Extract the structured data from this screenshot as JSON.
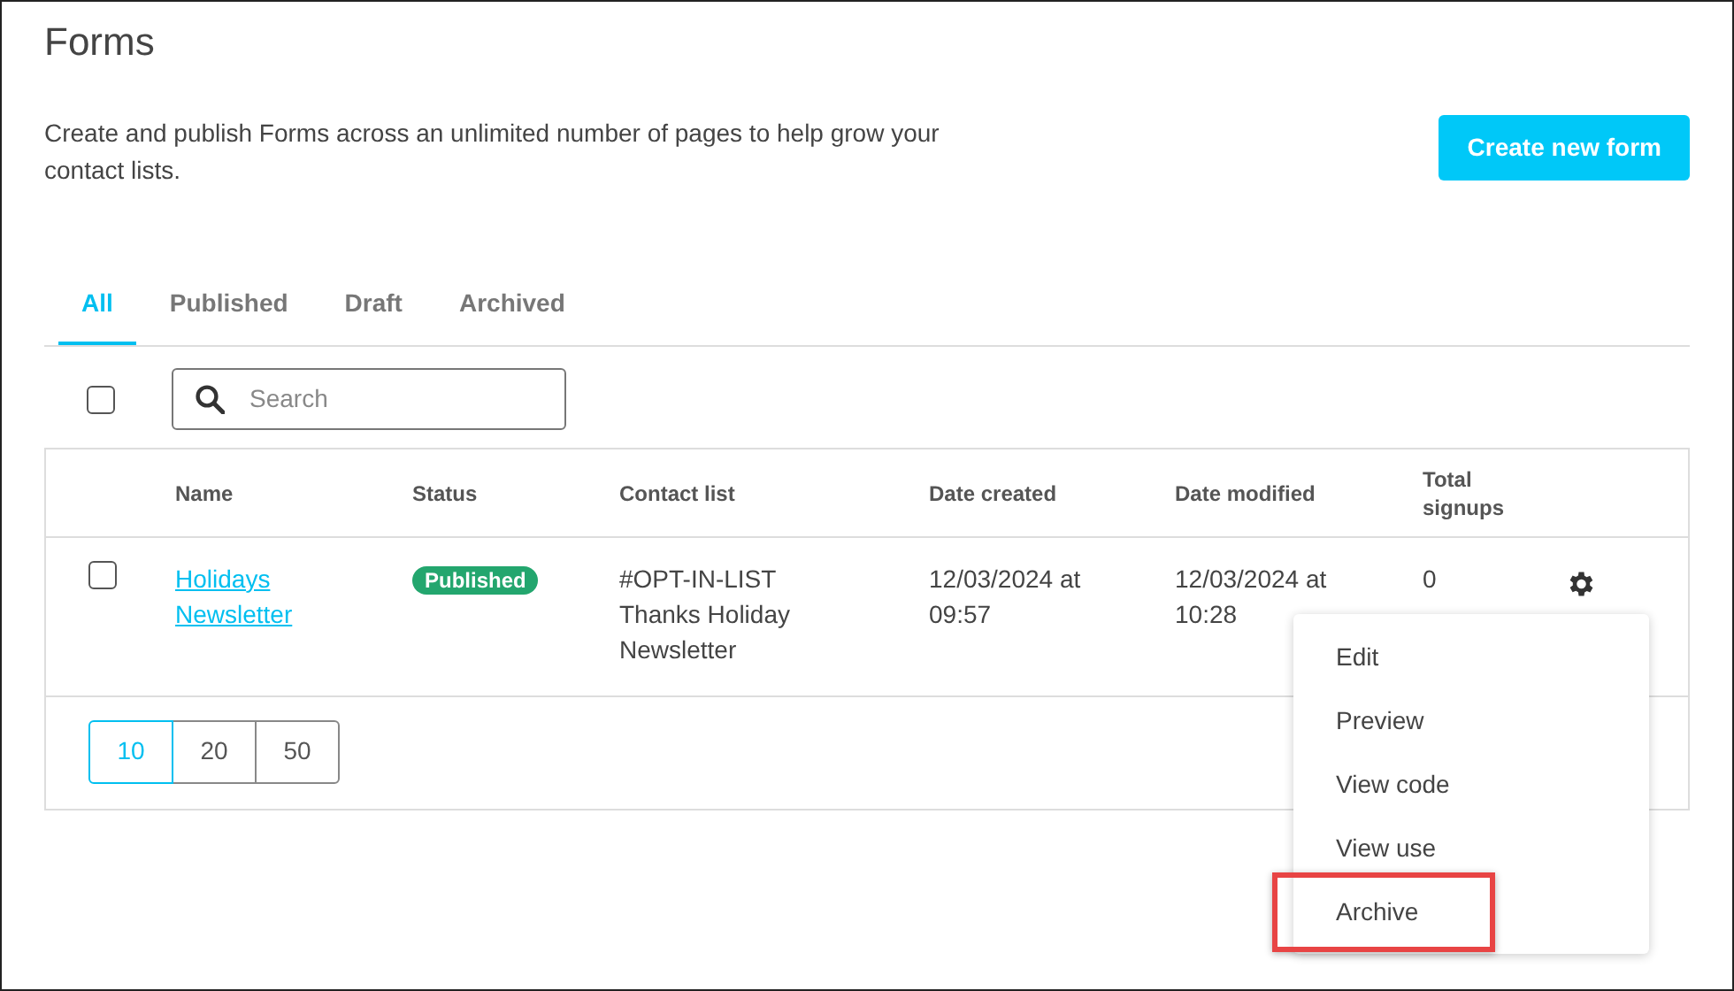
{
  "page": {
    "title": "Forms",
    "description": "Create and publish Forms across an unlimited number of pages to help grow your contact lists.",
    "create_button": "Create new form"
  },
  "tabs": [
    {
      "label": "All",
      "selected": true
    },
    {
      "label": "Published",
      "selected": false
    },
    {
      "label": "Draft",
      "selected": false
    },
    {
      "label": "Archived",
      "selected": false
    }
  ],
  "select_all": {
    "checked": false
  },
  "search": {
    "placeholder": "Search"
  },
  "table": {
    "columns": [
      "Name",
      "Status",
      "Contact list",
      "Date created",
      "Date modified",
      "Total signups"
    ],
    "rows": [
      {
        "checked": false,
        "name": "Holidays Newsletter",
        "status": "Published",
        "contact_list": "#OPT-IN-LIST Thanks Holiday Newsletter",
        "date_created": "12/03/2024 at 09:57",
        "date_modified": "12/03/2024 at 10:28",
        "total_signups": "0"
      }
    ]
  },
  "page_sizes": [
    {
      "label": "10",
      "selected": true
    },
    {
      "label": "20",
      "selected": false
    },
    {
      "label": "50",
      "selected": false
    }
  ],
  "row_menu": [
    {
      "label": "Edit",
      "highlighted": false
    },
    {
      "label": "Preview",
      "highlighted": false
    },
    {
      "label": "View code",
      "highlighted": false
    },
    {
      "label": "View use",
      "highlighted": false
    },
    {
      "label": "Archive",
      "highlighted": true
    }
  ]
}
